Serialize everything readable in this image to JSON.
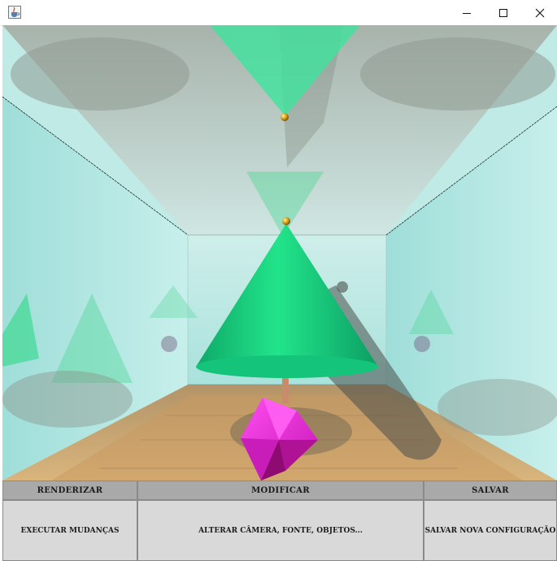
{
  "window": {
    "icons": {
      "app": "java-cup-icon",
      "minimize": "minimize-icon",
      "maximize": "maximize-icon",
      "close": "close-icon"
    }
  },
  "scene": {
    "description_icons": [
      "cone",
      "sphere",
      "octahedron",
      "cylinder"
    ],
    "colors": {
      "cone": "#16d680",
      "octahedron": "#e01fd2",
      "floor": "#c9a46e",
      "walls": "#bfeae6"
    }
  },
  "panel": {
    "columns": [
      {
        "header": "RENDERIZAR",
        "button": "EXECUTAR MUDANÇAS"
      },
      {
        "header": "MODIFICAR",
        "button": "ALTERAR CÂMERA, FONTE, OBJETOS..."
      },
      {
        "header": "SALVAR",
        "button": "SALVAR NOVA CONFIGURAÇÃO"
      }
    ]
  }
}
